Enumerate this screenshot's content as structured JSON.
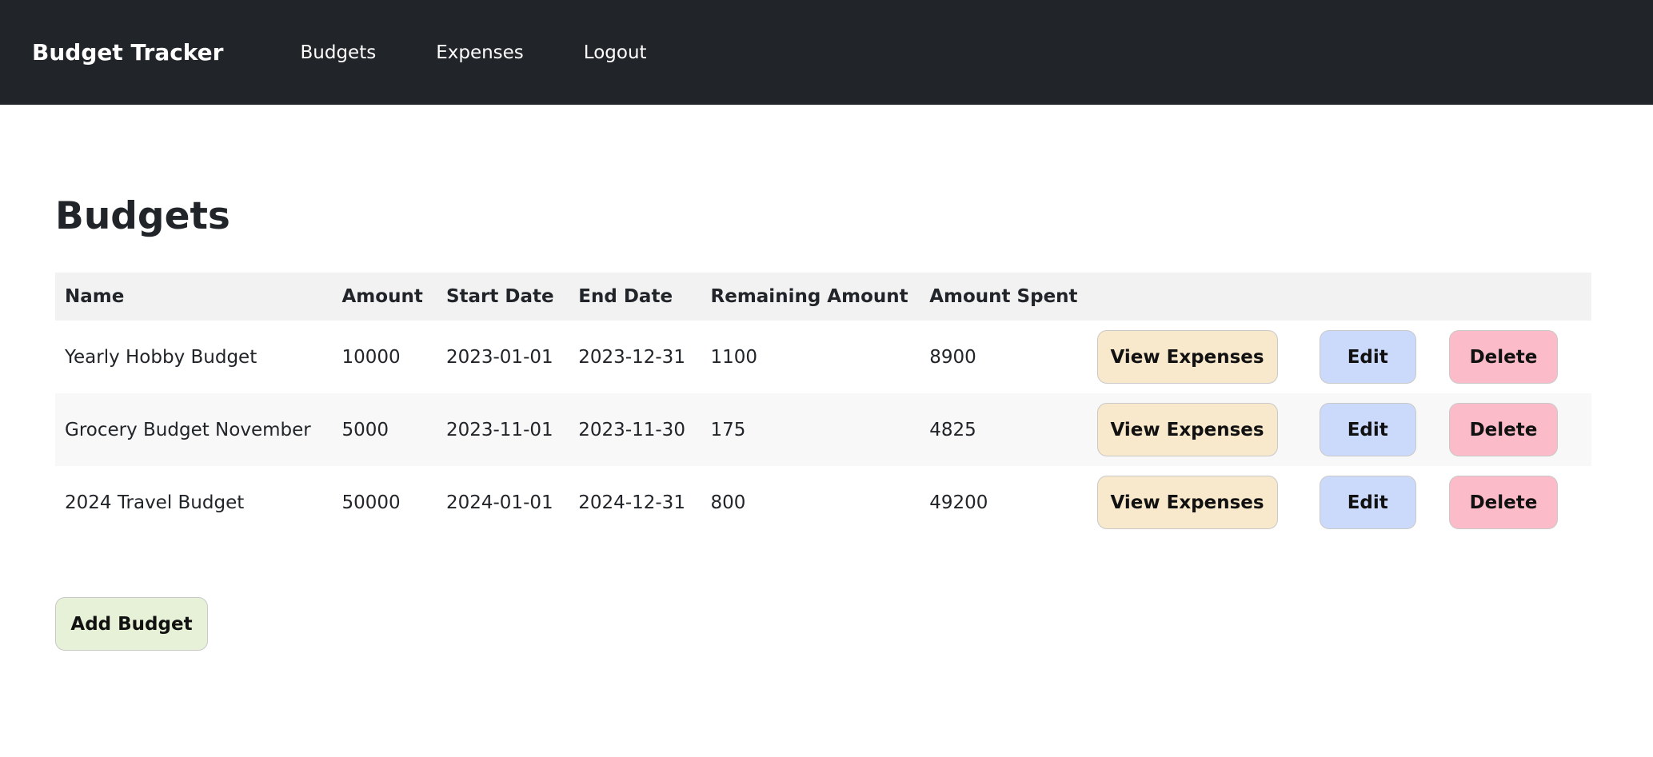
{
  "navbar": {
    "brand": "Budget Tracker",
    "links": [
      "Budgets",
      "Expenses",
      "Logout"
    ]
  },
  "page": {
    "title": "Budgets"
  },
  "table": {
    "headers": [
      "Name",
      "Amount",
      "Start Date",
      "End Date",
      "Remaining Amount",
      "Amount Spent"
    ],
    "rows": [
      [
        "Yearly Hobby Budget",
        "10000",
        "2023-01-01",
        "2023-12-31",
        "1100",
        "8900"
      ],
      [
        "Grocery Budget November",
        "5000",
        "2023-11-01",
        "2023-11-30",
        "175",
        "4825"
      ],
      [
        "2024 Travel Budget",
        "50000",
        "2024-01-01",
        "2024-12-31",
        "800",
        "49200"
      ]
    ],
    "actions": {
      "view_label": "View Expenses",
      "edit_label": "Edit",
      "delete_label": "Delete"
    }
  },
  "add_button_label": "Add Budget",
  "colors": {
    "navbar_bg": "#212529",
    "view_btn": "#f8e8cc",
    "edit_btn": "#cbdafb",
    "delete_btn": "#fbbbc9",
    "add_btn": "#e6f1d8",
    "header_row": "#f2f2f2"
  }
}
